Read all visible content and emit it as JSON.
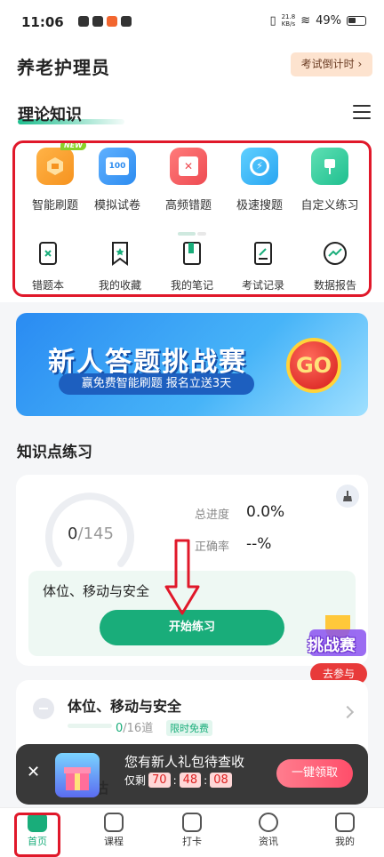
{
  "status_bar": {
    "time": "11:06",
    "netspeed": "21.8\nKB/s",
    "battery": "49%"
  },
  "app": {
    "title": "养老护理员",
    "countdown_label": "考试倒计时"
  },
  "section": {
    "title": "理论知识"
  },
  "grid": [
    {
      "label": "智能刷题",
      "icon": "smart-practice-icon",
      "color": "#f6931f",
      "badge": "NEW"
    },
    {
      "label": "模拟试卷",
      "icon": "mock-paper-icon",
      "color": "#2d8cf0",
      "glyph": "100"
    },
    {
      "label": "高频错题",
      "icon": "frequent-errors-icon",
      "color": "#ee4b52",
      "glyph": "✕"
    },
    {
      "label": "极速搜题",
      "icon": "quick-search-icon",
      "color": "#29a5f1",
      "glyph": "⚡"
    },
    {
      "label": "自定义练习",
      "icon": "custom-practice-icon",
      "color": "#1fbf8f",
      "glyph": "✎"
    }
  ],
  "outline_items": [
    {
      "label": "错题本",
      "icon": "wrong-book-icon"
    },
    {
      "label": "我的收藏",
      "icon": "favorites-icon"
    },
    {
      "label": "我的笔记",
      "icon": "notes-icon"
    },
    {
      "label": "考试记录",
      "icon": "exam-record-icon"
    },
    {
      "label": "数据报告",
      "icon": "data-report-icon"
    }
  ],
  "banner": {
    "title": "新人答题挑战赛",
    "subtitle": "赢免费智能刷题 报名立送3天",
    "go": "GO"
  },
  "knowledge": {
    "title": "知识点练习",
    "progress_done": "0",
    "progress_total": "145",
    "total_label": "总进度",
    "total_value": "0.0%",
    "accuracy_label": "正确率",
    "accuracy_value": "--%",
    "topic": "体位、移动与安全",
    "start_button": "开始练习"
  },
  "challenge": {
    "title": "挑战赛",
    "button": "去参与"
  },
  "list": [
    {
      "title": "体位、移动与安全",
      "done": "0",
      "total": "/16道",
      "tag": "限时免费"
    },
    {
      "title": "评估"
    }
  ],
  "toast": {
    "close": "✕",
    "message": "您有新人礼包待查收",
    "timer_prefix": "仅剩",
    "h": "70",
    "m": "48",
    "s": "08",
    "button": "一键领取"
  },
  "tabs": [
    {
      "label": "首页",
      "active": true
    },
    {
      "label": "课程"
    },
    {
      "label": "打卡"
    },
    {
      "label": "资讯"
    },
    {
      "label": "我的"
    }
  ],
  "colors": {
    "accent": "#19ad7a",
    "highlight_red": "#e0182a"
  }
}
